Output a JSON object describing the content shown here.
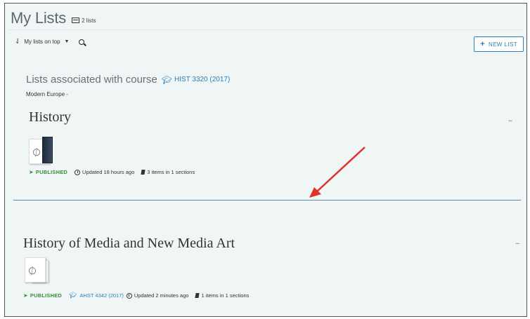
{
  "header": {
    "title": "My Lists",
    "count_label": "2 lists"
  },
  "toolbar": {
    "sort_label": "My lists on top",
    "new_list_label": "NEW LIST"
  },
  "course_group": {
    "heading": "Lists associated with course",
    "course_code": "HIST 3320 (2017)",
    "course_name": "Modern Europe -"
  },
  "lists": [
    {
      "title": "History",
      "status": "PUBLISHED",
      "updated": "Updated 18 hours ago",
      "items": "3 items in 1 sections",
      "more_label": "..."
    },
    {
      "title": "History of Media and New Media Art",
      "status": "PUBLISHED",
      "course_tag": "AHST 4342 (2017)",
      "updated": "Updated 2 minutes ago",
      "items": "1 items in 1 sections",
      "more_label": "..."
    }
  ],
  "colors": {
    "accent": "#2a7fb6",
    "published": "#3a8f3a",
    "annotation_arrow": "#e0342b",
    "background": "#f0f6f6"
  },
  "icons": [
    "list-count-icon",
    "sort-icon",
    "caret-down-icon",
    "search-icon",
    "plus-icon",
    "graduation-cap-icon",
    "paper-plane-icon",
    "clock-icon",
    "book-icon",
    "more-icon"
  ]
}
